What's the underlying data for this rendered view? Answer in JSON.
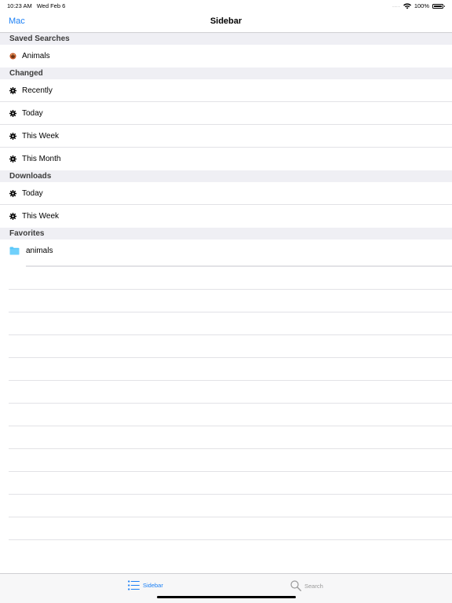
{
  "status_bar": {
    "time": "10:23 AM",
    "date": "Wed Feb 6",
    "signal": "....",
    "battery_label": "100%",
    "battery_level": 1.0
  },
  "nav": {
    "back_label": "Mac",
    "title": "Sidebar"
  },
  "sections": {
    "saved_searches": {
      "header": "Saved Searches",
      "items": [
        {
          "label": "Animals",
          "icon": "animal-icon"
        }
      ]
    },
    "changed": {
      "header": "Changed",
      "items": [
        {
          "label": "Recently",
          "icon": "gear-icon"
        },
        {
          "label": "Today",
          "icon": "gear-icon"
        },
        {
          "label": "This Week",
          "icon": "gear-icon"
        },
        {
          "label": "This Month",
          "icon": "gear-icon"
        }
      ]
    },
    "downloads": {
      "header": "Downloads",
      "items": [
        {
          "label": "Today",
          "icon": "gear-icon"
        },
        {
          "label": "This Week",
          "icon": "gear-icon"
        }
      ]
    },
    "favorites": {
      "header": "Favorites",
      "items": [
        {
          "label": "animals",
          "icon": "folder-icon"
        }
      ]
    }
  },
  "tab_bar": {
    "tabs": [
      {
        "label": "Sidebar",
        "icon": "list-icon",
        "active": true
      },
      {
        "label": "Search",
        "icon": "search-icon",
        "active": false
      }
    ]
  },
  "colors": {
    "accent": "#1a7ff5",
    "folder": "#5ac8fa",
    "section_bg": "#efeff4"
  }
}
